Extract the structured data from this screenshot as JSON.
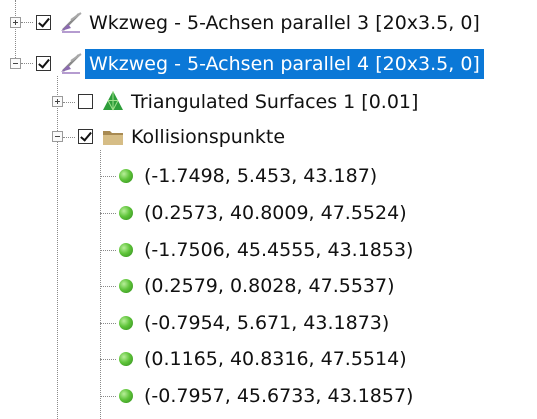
{
  "tree": {
    "items": [
      {
        "label": "Wkzweg - 5-Achsen parallel 3 [20x3.5, 0]",
        "icon": "toolpath-icon",
        "checked": true,
        "expander": "plus",
        "selected": false
      },
      {
        "label": "Wkzweg - 5-Achsen parallel 4 [20x3.5, 0]",
        "icon": "toolpath-icon",
        "checked": true,
        "expander": "minus",
        "selected": true
      },
      {
        "label": "Triangulated Surfaces 1 [0.01]",
        "icon": "triangle-surface-icon",
        "checked": false,
        "expander": "plus",
        "selected": false
      },
      {
        "label": "Kollisionspunkte",
        "icon": "folder-icon",
        "checked": true,
        "expander": "minus",
        "selected": false
      }
    ],
    "points": [
      "(-1.7498, 5.453, 43.187)",
      "(0.2573, 40.8009, 47.5524)",
      "(-1.7506, 45.4555, 43.1853)",
      "(0.2579, 0.8028, 47.5537)",
      "(-0.7954, 5.671, 43.1873)",
      "(0.1165, 40.8316, 47.5514)",
      "(-0.7957, 45.6733, 43.1857)"
    ],
    "colors": {
      "selection": "#0b78d7",
      "point_green": "#5fc43a",
      "triangle_green": "#2e9e3a",
      "folder": "#b0925a"
    }
  }
}
